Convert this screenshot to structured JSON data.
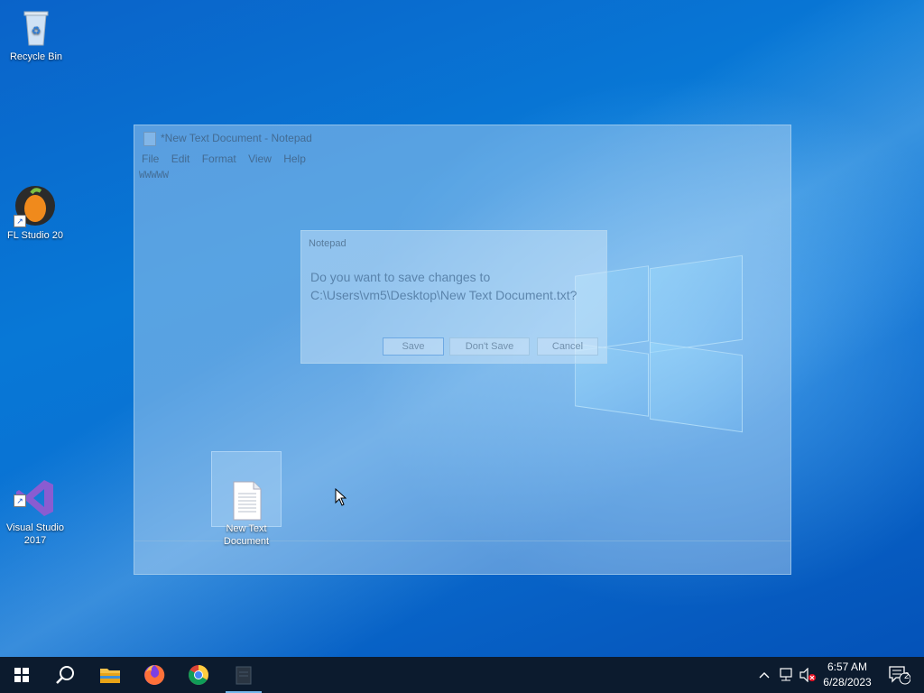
{
  "desktop": {
    "icons": [
      {
        "label": "Recycle Bin"
      },
      {
        "label": "FL Studio 20"
      },
      {
        "label": "Visual Studio\n2017"
      },
      {
        "label": "New Text\nDocument"
      }
    ]
  },
  "notepad": {
    "title": "*New Text Document - Notepad",
    "menu": [
      "File",
      "Edit",
      "Format",
      "View",
      "Help"
    ],
    "content": "WWWWW"
  },
  "dialog": {
    "title": "Notepad",
    "message": "Do you want to save changes to\nC:\\Users\\vm5\\Desktop\\New Text Document.txt?",
    "buttons": {
      "save": "Save",
      "dont_save": "Don't Save",
      "cancel": "Cancel"
    }
  },
  "taskbar": {
    "pinned": [
      "windows-start-icon",
      "search-icon",
      "file-explorer-icon",
      "firefox-icon",
      "chrome-icon",
      "notepad-icon"
    ],
    "tray": {
      "time": "6:57 AM",
      "date": "6/28/2023",
      "notification_count": "2"
    }
  },
  "colors": {
    "desktop_blue": "#0878d6",
    "taskbar": "#0c1b2e",
    "accent": "#76b9ed"
  }
}
